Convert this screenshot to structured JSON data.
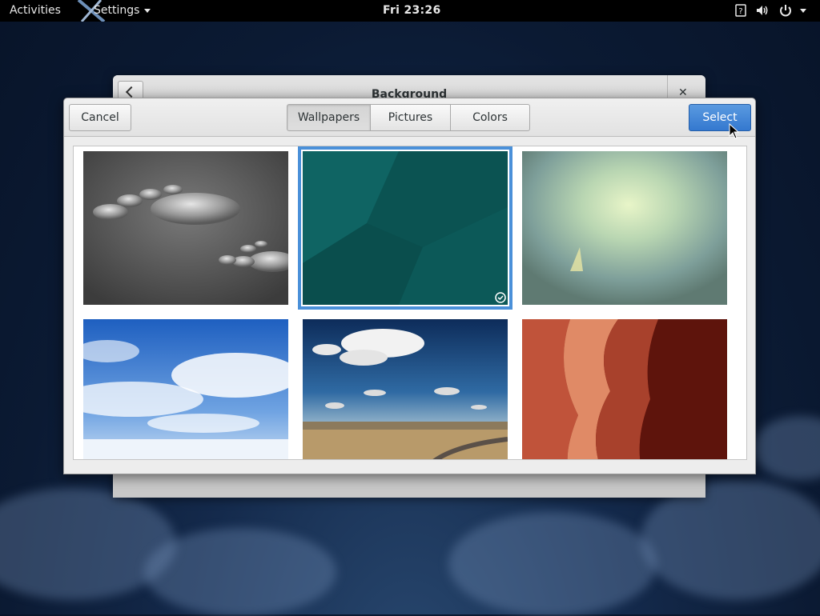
{
  "topbar": {
    "activities_label": "Activities",
    "app_menu_label": "Settings",
    "clock": "Fri 23:26",
    "icons": [
      "accessibility-icon",
      "volume-icon",
      "power-icon"
    ]
  },
  "settings_window": {
    "title": "Background"
  },
  "dialog": {
    "cancel_label": "Cancel",
    "select_label": "Select",
    "tabs": [
      {
        "label": "Wallpapers",
        "active": true
      },
      {
        "label": "Pictures",
        "active": false
      },
      {
        "label": "Colors",
        "active": false
      }
    ],
    "wallpapers": [
      {
        "name": "water-drops-wallpaper",
        "selected": false
      },
      {
        "name": "teal-texture-wallpaper",
        "selected": true
      },
      {
        "name": "light-glow-wallpaper",
        "selected": false
      },
      {
        "name": "blue-sky-clouds-wallpaper",
        "selected": false
      },
      {
        "name": "desert-road-wallpaper",
        "selected": false
      },
      {
        "name": "red-canyon-wallpaper",
        "selected": false
      }
    ]
  },
  "colors": {
    "accent": "#4a90d9",
    "select_button": "#3478cf",
    "topbar": "#000000"
  }
}
